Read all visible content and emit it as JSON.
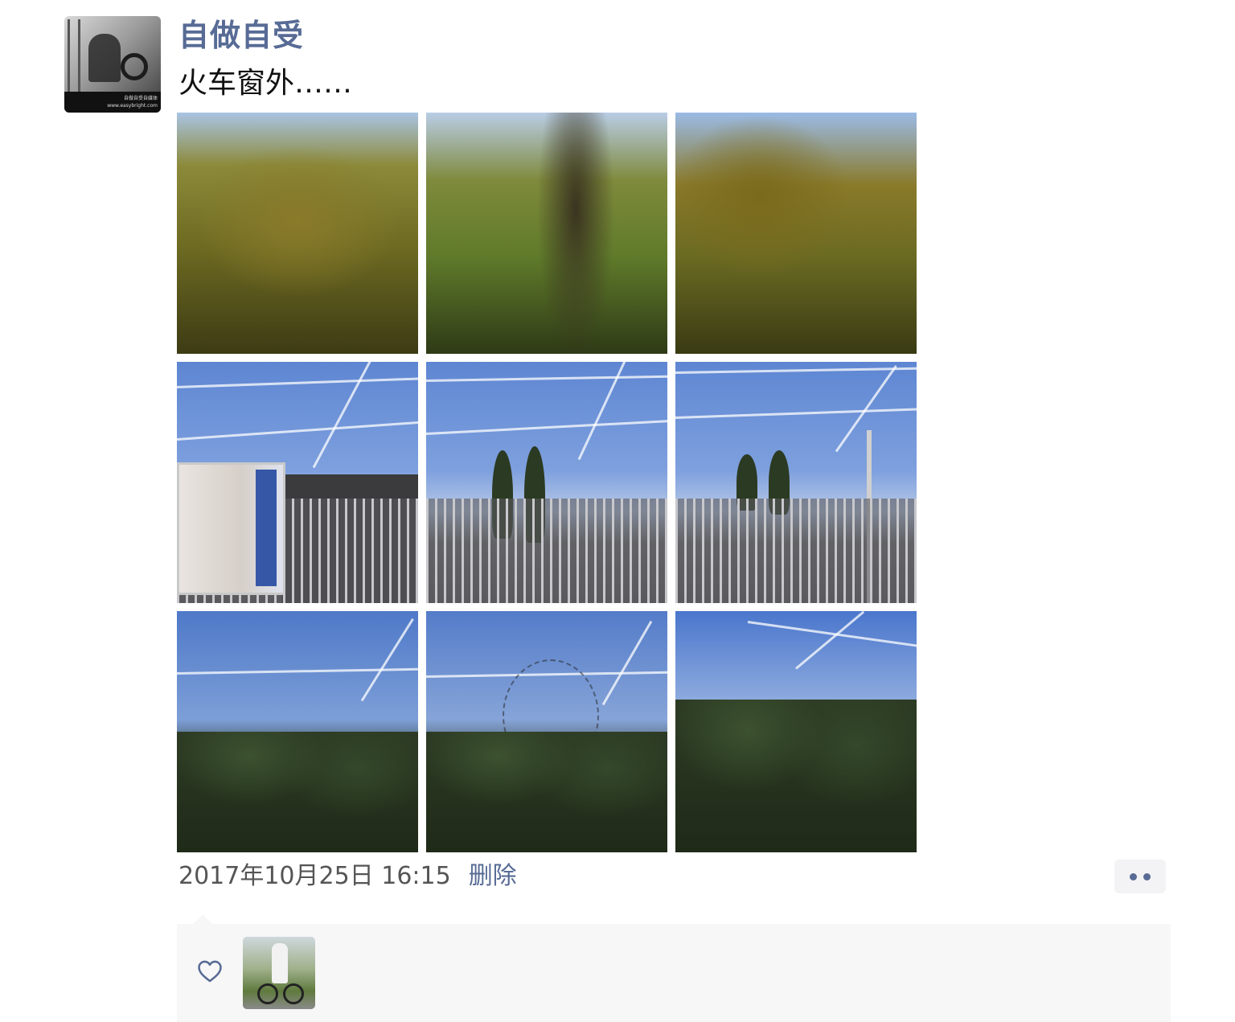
{
  "post": {
    "author": "自做自受",
    "text": "火车窗外……",
    "avatar_label": "自做自受自媒体 www.easybright.com",
    "photos": [
      {
        "name": "photo-autumn-trees-1"
      },
      {
        "name": "photo-autumn-trees-2"
      },
      {
        "name": "photo-autumn-trees-3"
      },
      {
        "name": "photo-station-billboard"
      },
      {
        "name": "photo-station-fence"
      },
      {
        "name": "photo-station-platform"
      },
      {
        "name": "photo-evening-hedge-1"
      },
      {
        "name": "photo-evening-bare-tree"
      },
      {
        "name": "photo-evening-hedge-2"
      }
    ],
    "timestamp": "2017年10月25日 16:15",
    "delete_label": "删除",
    "more_icon": "more-dots-icon"
  },
  "likes": {
    "icon": "heart-outline-icon",
    "count": 1
  },
  "colors": {
    "link": "#576b95",
    "text": "#111111",
    "muted": "#555555",
    "likes_background": "#f7f7f7",
    "more_button_background": "#f3f3f5"
  }
}
